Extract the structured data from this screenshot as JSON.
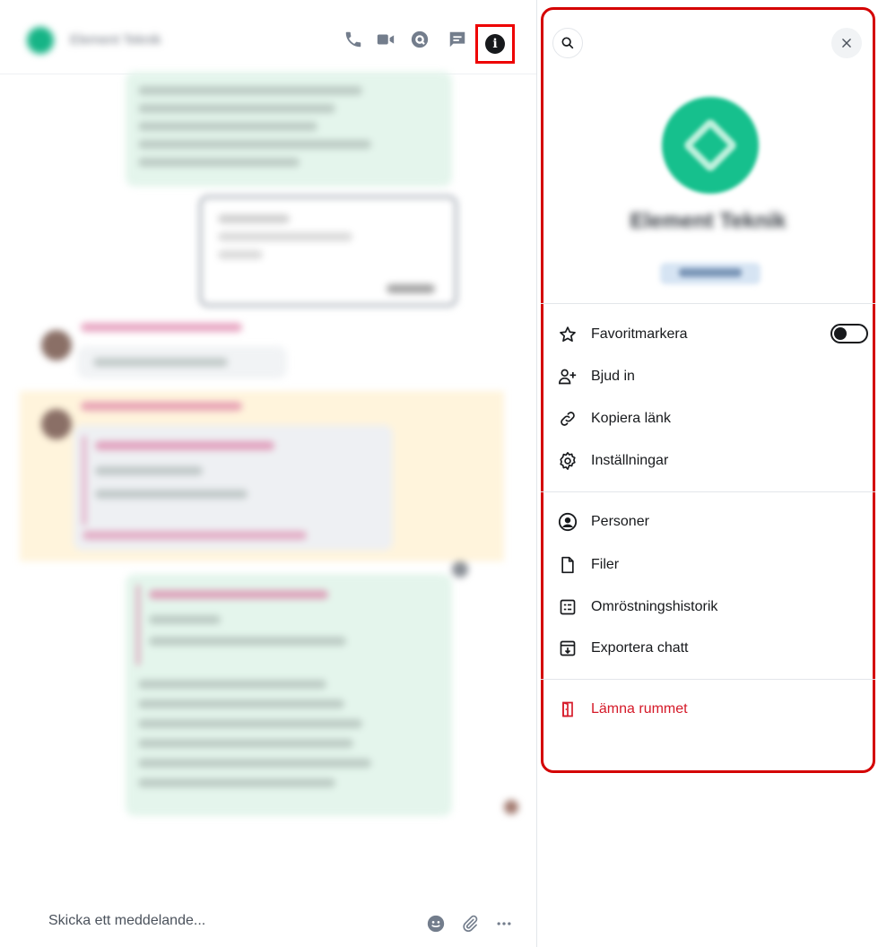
{
  "header": {
    "room_name": "Element Teknik",
    "icons": [
      "phone-icon",
      "video-icon",
      "threads-icon",
      "chat-icon",
      "info-icon"
    ]
  },
  "composer": {
    "placeholder": "Skicka ett meddelande...",
    "icons": [
      "emoji-icon",
      "attach-icon",
      "more-icon"
    ]
  },
  "right_panel": {
    "room_name": "Element Teknik",
    "menu_primary": [
      {
        "label": "Favoritmarkera",
        "icon": "star-icon",
        "toggle": false
      },
      {
        "label": "Bjud in",
        "icon": "invite-user-icon"
      },
      {
        "label": "Kopiera länk",
        "icon": "link-icon"
      },
      {
        "label": "Inställningar",
        "icon": "gear-icon"
      }
    ],
    "menu_secondary": [
      {
        "label": "Personer",
        "icon": "person-icon"
      },
      {
        "label": "Filer",
        "icon": "file-icon"
      },
      {
        "label": "Omröstningshistorik",
        "icon": "poll-icon"
      },
      {
        "label": "Exportera chatt",
        "icon": "export-icon"
      }
    ],
    "menu_leave": {
      "label": "Lämna rummet",
      "icon": "leave-door-icon"
    }
  },
  "colors": {
    "accent_green": "#16b486",
    "danger": "#d51928",
    "highlight_border": "#d40000",
    "bubble_green": "#e4f5ec",
    "highlight_yellow": "#fff4dc"
  }
}
